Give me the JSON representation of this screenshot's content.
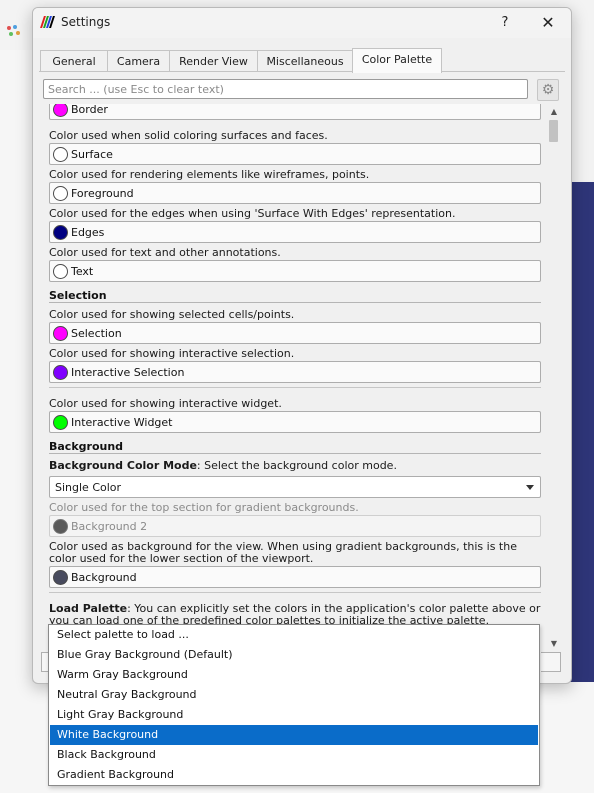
{
  "window": {
    "title": "Settings",
    "help_label": "?",
    "close_label": "✕"
  },
  "tabs": [
    {
      "label": "General",
      "active": false
    },
    {
      "label": "Camera",
      "active": false
    },
    {
      "label": "Render View",
      "active": false
    },
    {
      "label": "Miscellaneous",
      "active": false
    },
    {
      "label": "Color Palette",
      "active": true
    }
  ],
  "search": {
    "placeholder": "Search ... (use Esc to clear text)",
    "value": ""
  },
  "gear_icon": "⚙",
  "scroll": {
    "up_arrow": "▲",
    "down_arrow": "▼"
  },
  "colors": {
    "border": "#ff00ff",
    "surface": "#ffffff",
    "foreground": "#ffffff",
    "edges": "#000080",
    "text": "#ffffff",
    "selection": "#ff00ff",
    "interactive_selection": "#7f00ff",
    "interactive_widget": "#00ff00",
    "background2": "#5a5a5a",
    "background": "#484b5e",
    "accent": "#0a6cc9"
  },
  "items": {
    "border": {
      "label": "Border"
    },
    "surface": {
      "desc": "Color used when solid coloring surfaces and faces.",
      "label": "Surface"
    },
    "foreground": {
      "desc": "Color used for rendering elements like wireframes, points.",
      "label": "Foreground"
    },
    "edges": {
      "desc": "Color used for the edges when using 'Surface With Edges' representation.",
      "label": "Edges"
    },
    "text": {
      "desc": "Color used for text and other annotations.",
      "label": "Text"
    },
    "selection_section": "Selection",
    "selection": {
      "desc": "Color used for showing selected cells/points.",
      "label": "Selection"
    },
    "interactive_selection": {
      "desc": "Color used for showing interactive selection.",
      "label": "Interactive Selection"
    },
    "interactive_widget": {
      "desc": "Color used for showing interactive widget.",
      "label": "Interactive Widget"
    },
    "background_section": "Background",
    "bg_mode": {
      "bold": "Background Color Mode",
      "desc": ": Select the background color mode.",
      "value": "Single Color"
    },
    "background2": {
      "desc": "Color used for the top section for gradient backgrounds.",
      "label": "Background 2"
    },
    "background": {
      "desc": "Color used as background for the view. When using gradient backgrounds, this is the color used for the lower section of the viewport.",
      "label": "Background"
    },
    "load_palette": {
      "bold": "Load Palette",
      "desc": ": You can explicitly set the colors in the application's color palette above or you can load one of the predefined color palettes to initialize the active palette."
    }
  },
  "palette_options": [
    "Select palette to load ...",
    "Blue Gray Background (Default)",
    "Warm Gray Background",
    "Neutral Gray Background",
    "Light Gray Background",
    "White Background",
    "Black Background",
    "Gradient Background"
  ],
  "palette_selected_index": 5
}
